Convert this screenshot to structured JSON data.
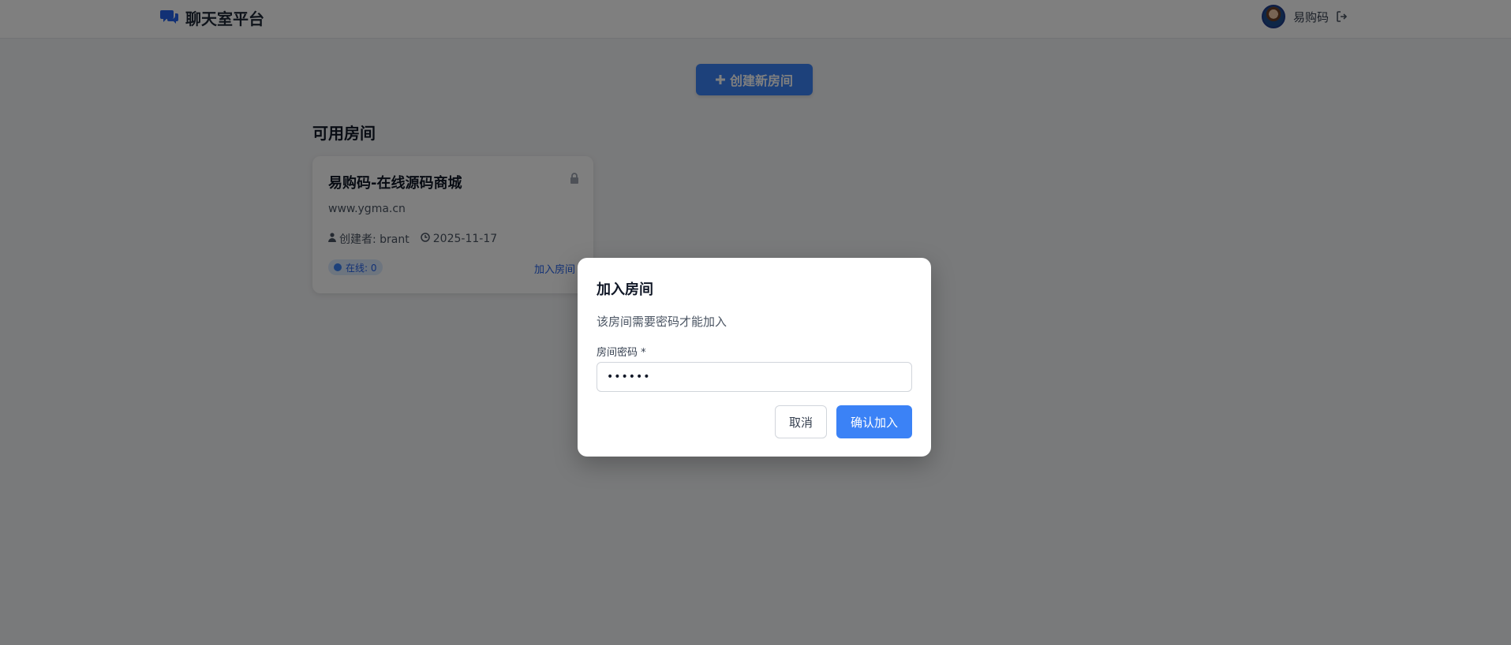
{
  "header": {
    "brand_title": "聊天室平台",
    "brand_icon": "comments-icon",
    "user_name": "易购码",
    "logout_icon": "sign-out-icon"
  },
  "main": {
    "create_button_label": "创建新房间",
    "section_title": "可用房间",
    "rooms": [
      {
        "title": "易购码-在线源码商城",
        "description": "www.ygma.cn",
        "creator": "创建者: brant",
        "date": "2025-11-17",
        "online": "在线: 0",
        "join_label": "加入房间",
        "locked": true
      }
    ]
  },
  "modal": {
    "title": "加入房间",
    "message": "该房间需要密码才能加入",
    "field_label": "房间密码 *",
    "password_value": "123456",
    "cancel_label": "取消",
    "confirm_label": "确认加入"
  },
  "colors": {
    "primary": "#3b82f6",
    "overlay": "rgba(0,0,0,0.5)",
    "background": "#f3f4f6"
  }
}
